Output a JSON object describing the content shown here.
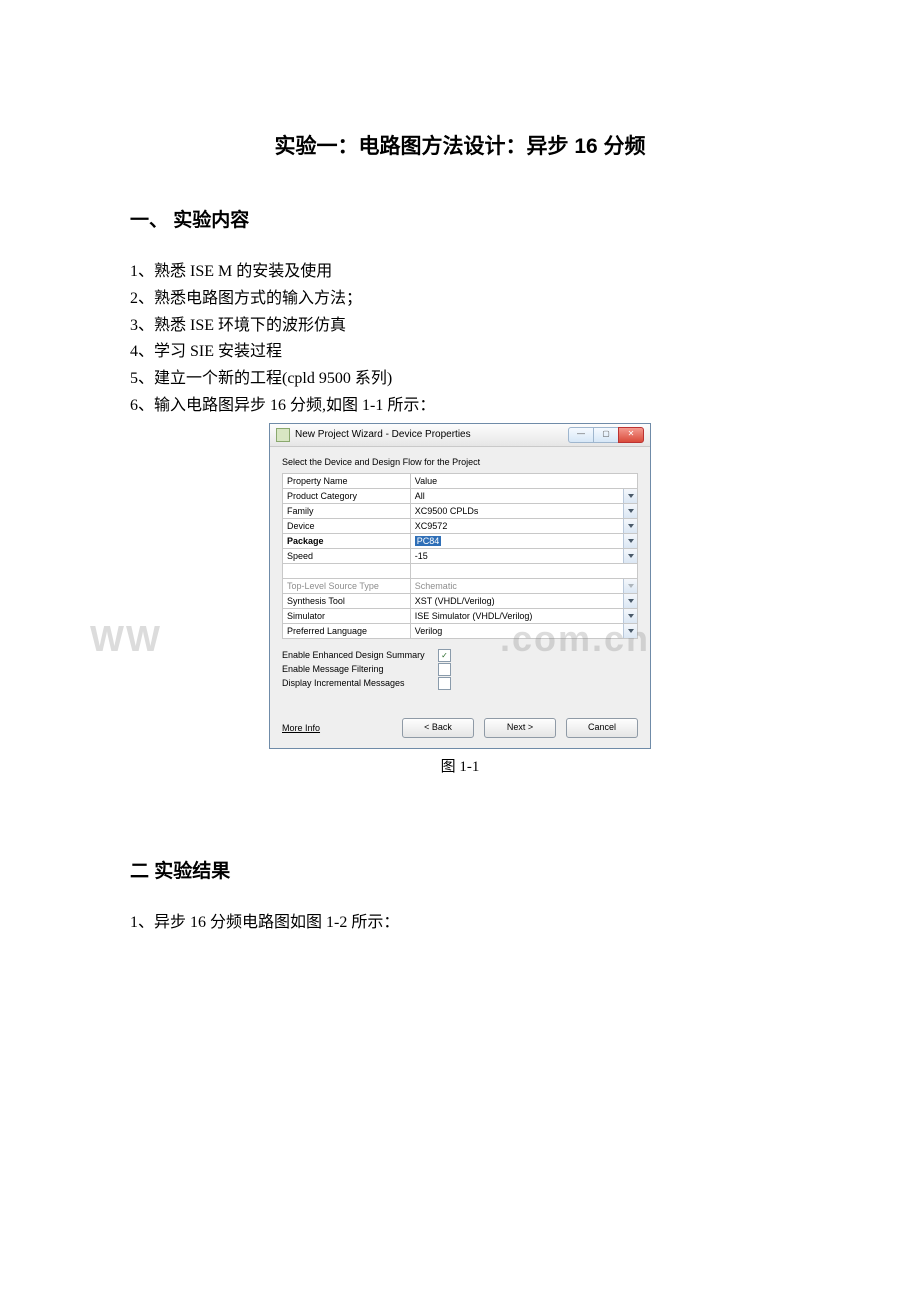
{
  "title": "实验一：电路图方法设计：异步 16 分频",
  "section1": {
    "heading": "一、 实验内容",
    "items": [
      "1、熟悉 ISE M 的安装及使用",
      "2、熟悉电路图方式的输入方法；",
      "3、熟悉 ISE 环境下的波形仿真",
      "4、学习 SIE 安装过程",
      "5、建立一个新的工程(cpld 9500 系列)",
      "6、输入电路图异步 16 分频,如图 1-1 所示："
    ]
  },
  "dialog": {
    "title": "New Project Wizard - Device Properties",
    "instruction": "Select the Device and Design Flow for the Project",
    "header": {
      "name": "Property Name",
      "value": "Value"
    },
    "rows": [
      {
        "name": "Product Category",
        "value": "All",
        "dropdown": true
      },
      {
        "name": "Family",
        "value": "XC9500 CPLDs",
        "dropdown": true
      },
      {
        "name": "Device",
        "value": "XC9572",
        "dropdown": true
      },
      {
        "name": "Package",
        "value": "PC84",
        "dropdown": true,
        "bold": true,
        "highlight": true
      },
      {
        "name": "Speed",
        "value": "-15",
        "dropdown": true
      }
    ],
    "rows2": [
      {
        "name": "Top-Level Source Type",
        "value": "Schematic",
        "dropdown": true,
        "disabled": true
      },
      {
        "name": "Synthesis Tool",
        "value": "XST (VHDL/Verilog)",
        "dropdown": true
      },
      {
        "name": "Simulator",
        "value": "ISE Simulator (VHDL/Verilog)",
        "dropdown": true
      },
      {
        "name": "Preferred Language",
        "value": "Verilog",
        "dropdown": true
      }
    ],
    "checks": [
      {
        "label": "Enable Enhanced Design Summary",
        "checked": true
      },
      {
        "label": "Enable Message Filtering",
        "checked": false
      },
      {
        "label": "Display Incremental Messages",
        "checked": false
      }
    ],
    "buttons": {
      "more": "More Info",
      "back": "< Back",
      "next": "Next >",
      "cancel": "Cancel"
    }
  },
  "figure_caption": "图 1-1",
  "watermark_left": "WW",
  "watermark_right": ".com.cn",
  "section2": {
    "heading": "二  实验结果",
    "items": [
      "1、异步 16 分频电路图如图 1-2 所示："
    ]
  }
}
